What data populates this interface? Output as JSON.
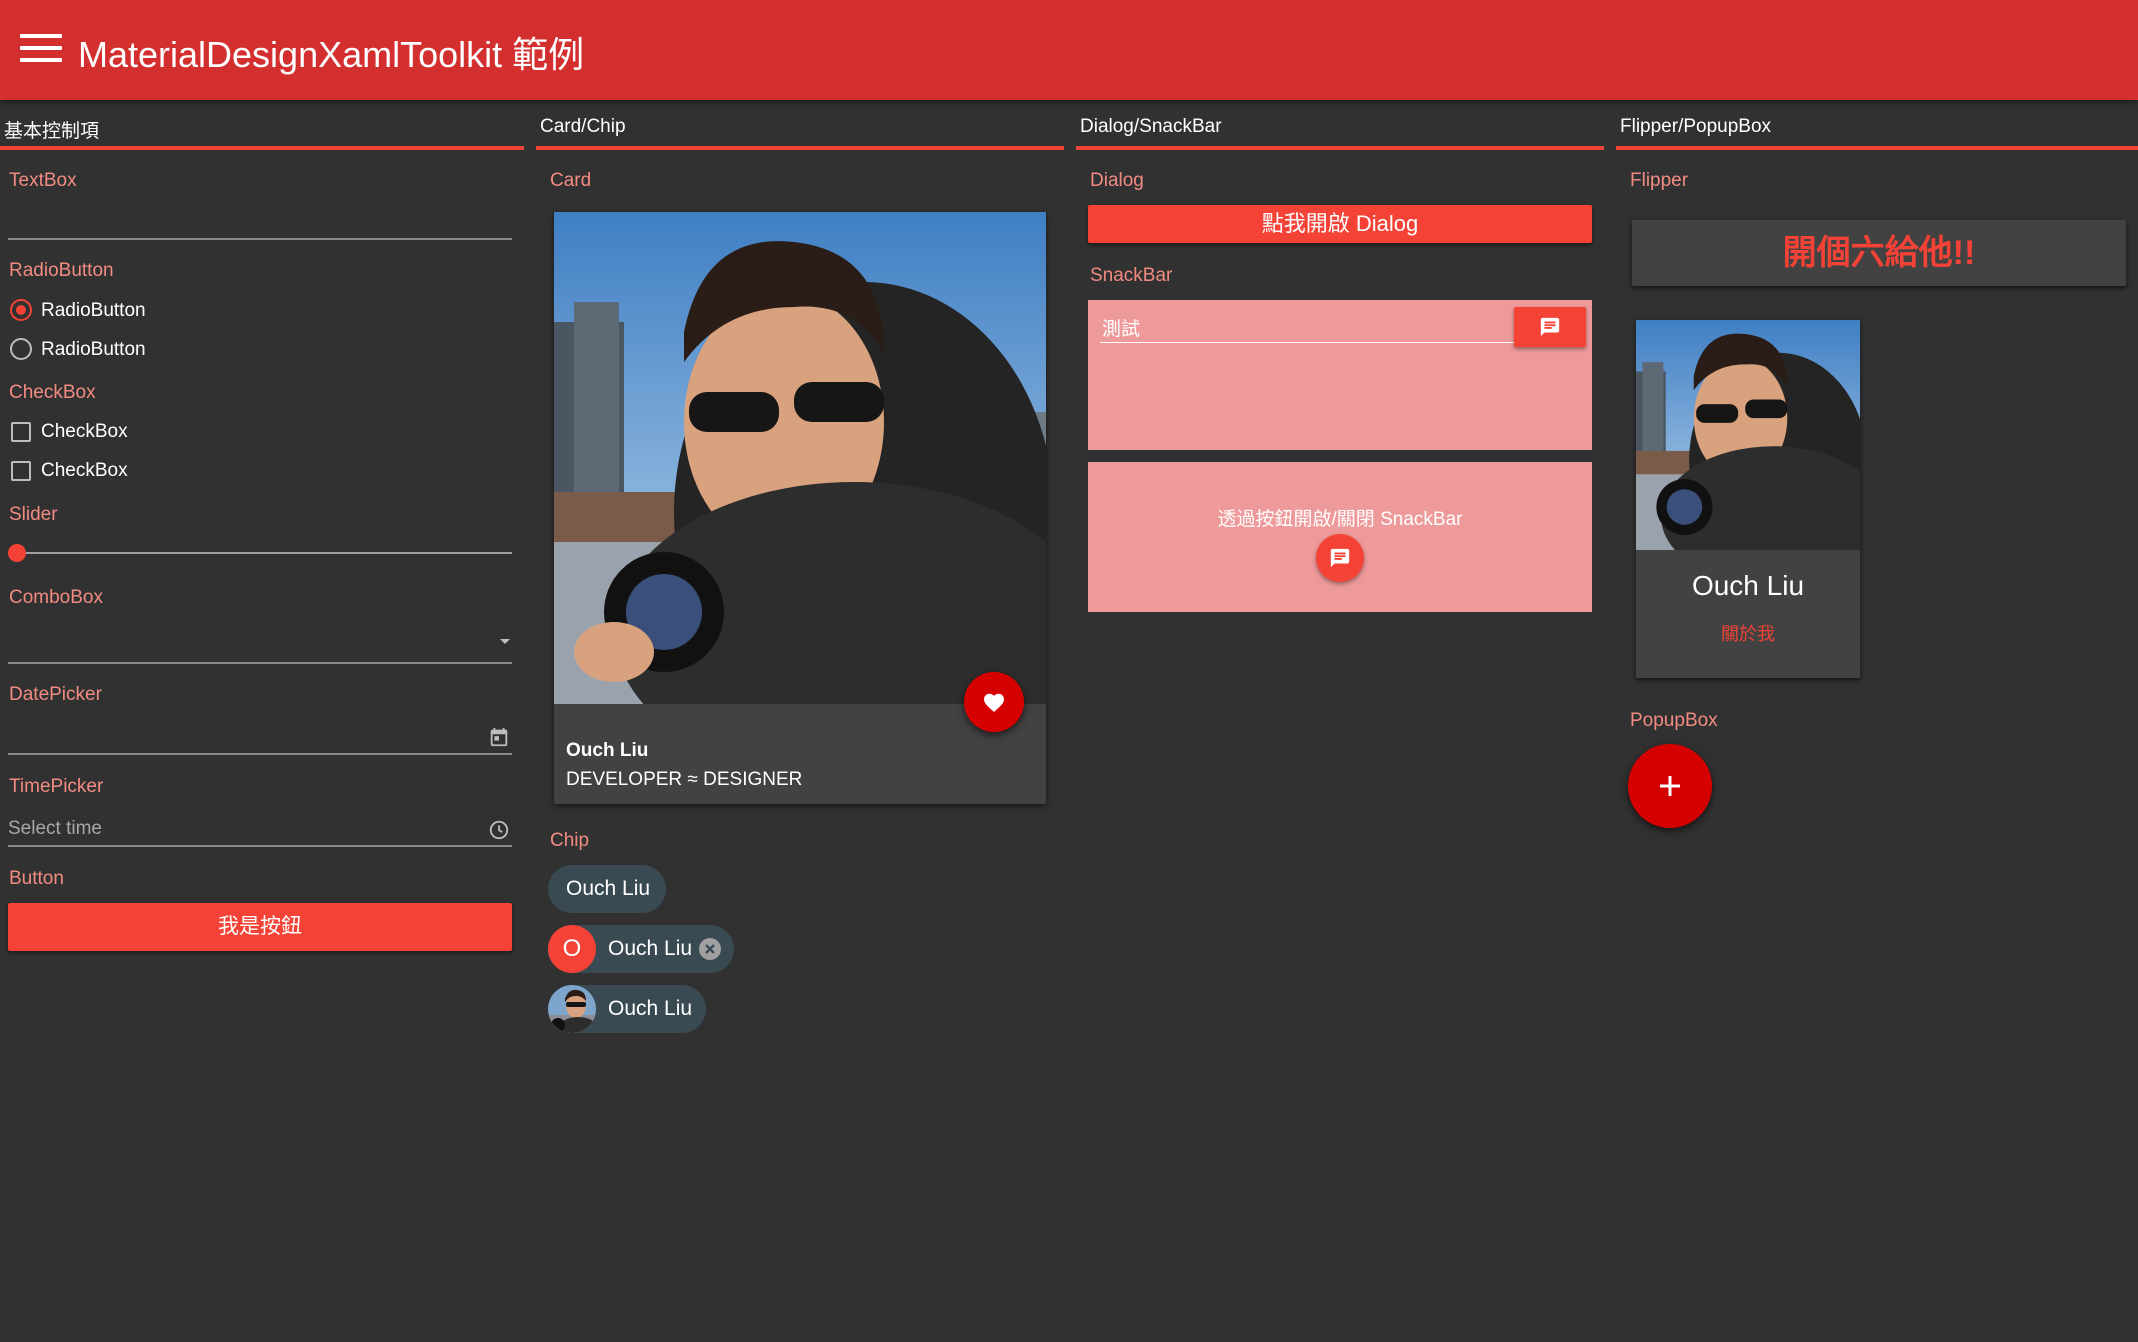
{
  "app": {
    "title": "MaterialDesignXamlToolkit 範例"
  },
  "tabs": [
    {
      "label": "基本控制項"
    },
    {
      "label": "Card/Chip"
    },
    {
      "label": "Dialog/SnackBar"
    },
    {
      "label": "Flipper/PopupBox"
    }
  ],
  "basic": {
    "textbox_heading": "TextBox",
    "radio_heading": "RadioButton",
    "radio_1": "RadioButton",
    "radio_2": "RadioButton",
    "check_heading": "CheckBox",
    "check_1": "CheckBox",
    "check_2": "CheckBox",
    "slider_heading": "Slider",
    "slider_value": 0,
    "combo_heading": "ComboBox",
    "date_heading": "DatePicker",
    "time_heading": "TimePicker",
    "time_placeholder": "Select time",
    "button_heading": "Button",
    "button_label": "我是按鈕"
  },
  "cardchip": {
    "card_heading": "Card",
    "card_name": "Ouch Liu",
    "card_subtitle": "DEVELOPER ≈ DESIGNER",
    "chip_heading": "Chip",
    "chip_1": "Ouch Liu",
    "chip_2_icon": "O",
    "chip_2": "Ouch Liu",
    "chip_3": "Ouch Liu"
  },
  "dialog": {
    "dialog_heading": "Dialog",
    "dialog_button": "點我開啟 Dialog",
    "snackbar_heading": "SnackBar",
    "snackbar_input": "測試",
    "snackbar_toggle_text": "透過按鈕開啟/關閉 SnackBar"
  },
  "flipper": {
    "flipper_heading": "Flipper",
    "flipper_button": "開個六給他!!",
    "flip_name": "Ouch Liu",
    "flip_link": "關於我",
    "popup_heading": "PopupBox"
  },
  "colors": {
    "primary": "#d32f2f",
    "accent": "#f44336",
    "accent_light": "#ef9a9a",
    "background": "#313131",
    "card": "#424242"
  }
}
